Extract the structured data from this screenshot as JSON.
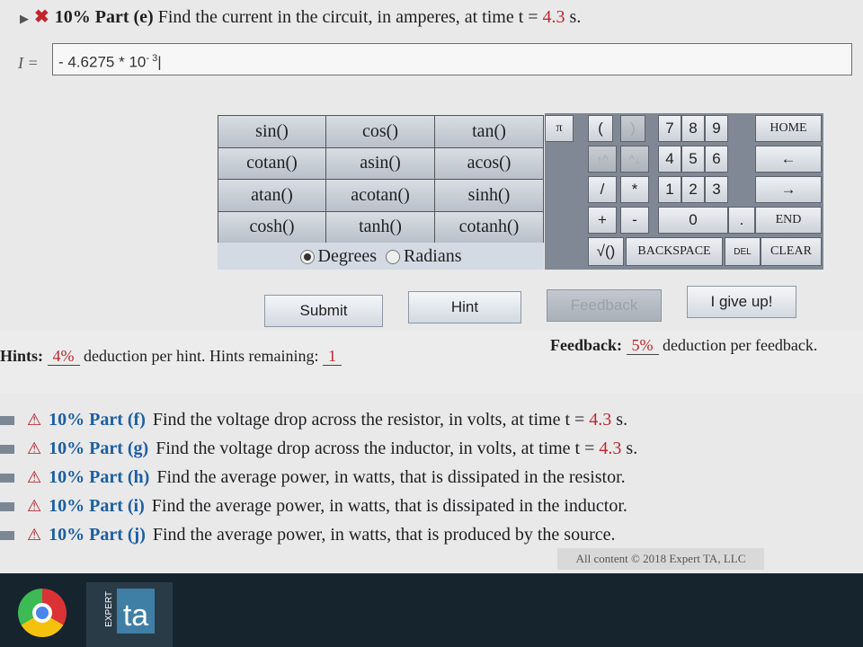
{
  "header": {
    "pct": "10% Part (e)",
    "prefix": "Find the current in the circuit, in amperes, at time t =",
    "time": "4.3",
    "unit": "s."
  },
  "answer": {
    "label": "I =",
    "mantissa": "- 4.6275 * 10",
    "exponent": "- 3"
  },
  "functions": [
    "sin()",
    "cos()",
    "tan()",
    "cotan()",
    "asin()",
    "acos()",
    "atan()",
    "acotan()",
    "sinh()",
    "cosh()",
    "tanh()",
    "cotanh()"
  ],
  "angle_mode": {
    "degrees": "Degrees",
    "radians": "Radians",
    "selected": "Degrees"
  },
  "keypad": {
    "pi": "π",
    "lparen": "(",
    "rparen": ")",
    "k7": "7",
    "k8": "8",
    "k9": "9",
    "home": "HOME",
    "up": "↑^",
    "down": "^↓",
    "k4": "4",
    "k5": "5",
    "k6": "6",
    "left": "←",
    "divide": "/",
    "multiply": "*",
    "k1": "1",
    "k2": "2",
    "k3": "3",
    "right": "→",
    "plus": "+",
    "minus": "-",
    "k0": "0",
    "dot": ".",
    "end": "END",
    "sqrt": "√()",
    "backspace": "BACKSPACE",
    "del": "DEL",
    "clear": "CLEAR"
  },
  "buttons": {
    "submit": "Submit",
    "hint": "Hint",
    "feedback": "Feedback",
    "give_up": "I give up!"
  },
  "hints": {
    "label": "Hints:",
    "deduction": "4%",
    "suffix": "deduction per hint. Hints remaining:",
    "remaining": "1"
  },
  "feedback": {
    "label": "Feedback:",
    "deduction": "5%",
    "suffix": "deduction per feedback."
  },
  "parts": [
    {
      "pct": "10% Part (f)",
      "text": "Find the voltage drop across the resistor, in volts, at time t =",
      "time": "4.3",
      "unit": "s."
    },
    {
      "pct": "10% Part (g)",
      "text": "Find the voltage drop across the inductor, in volts, at time t =",
      "time": "4.3",
      "unit": "s."
    },
    {
      "pct": "10% Part (h)",
      "text": "Find the average power, in watts, that is dissipated in the resistor.",
      "time": "",
      "unit": ""
    },
    {
      "pct": "10% Part (i)",
      "text": "Find the average power, in watts, that is dissipated in the inductor.",
      "time": "",
      "unit": ""
    },
    {
      "pct": "10% Part (j)",
      "text": "Find the average power, in watts, that is produced by the source.",
      "time": "",
      "unit": ""
    }
  ],
  "footer": "All content © 2018 Expert TA, LLC",
  "taskbar": {
    "app_letters": "ta",
    "app_side": "EXPERT"
  },
  "colors": {
    "accent_red": "#c0272d",
    "part_blue": "#1c5ea0"
  }
}
